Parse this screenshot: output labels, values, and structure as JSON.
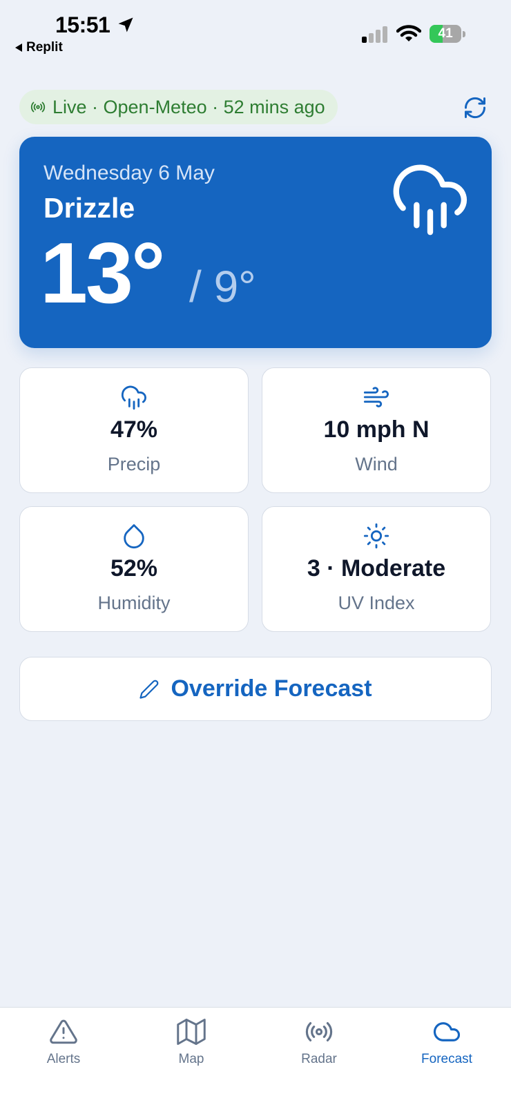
{
  "status_bar": {
    "time": "15:51",
    "back_app": "Replit",
    "battery": "41",
    "battery_level_percent": 41
  },
  "source": {
    "live_text": "Live · Open-Meteo · 52 mins ago"
  },
  "hero": {
    "date": "Wednesday 6 May",
    "condition": "Drizzle",
    "high": "13°",
    "low": "/ 9°",
    "icon": "cloud-rain-icon"
  },
  "stats": {
    "precip": {
      "value": "47%",
      "label": "Precip",
      "icon": "cloud-rain-icon"
    },
    "wind": {
      "value": "10 mph N",
      "label": "Wind",
      "icon": "wind-icon"
    },
    "humidity": {
      "value": "52%",
      "label": "Humidity",
      "icon": "droplet-icon"
    },
    "uv": {
      "value": "3 · Moderate",
      "label": "UV Index",
      "icon": "sun-icon"
    }
  },
  "override": {
    "label": "Override Forecast",
    "icon": "pencil-icon"
  },
  "tabs": [
    {
      "label": "Alerts",
      "icon": "alert-triangle-icon",
      "active": false
    },
    {
      "label": "Map",
      "icon": "map-icon",
      "active": false
    },
    {
      "label": "Radar",
      "icon": "radar-icon",
      "active": false
    },
    {
      "label": "Forecast",
      "icon": "cloud-icon",
      "active": true
    }
  ],
  "colors": {
    "accent": "#1565c0",
    "live_green": "#2e7d32",
    "live_pill_bg": "#e3f1e3",
    "background": "#edf1f8",
    "muted_text": "#64748b"
  }
}
